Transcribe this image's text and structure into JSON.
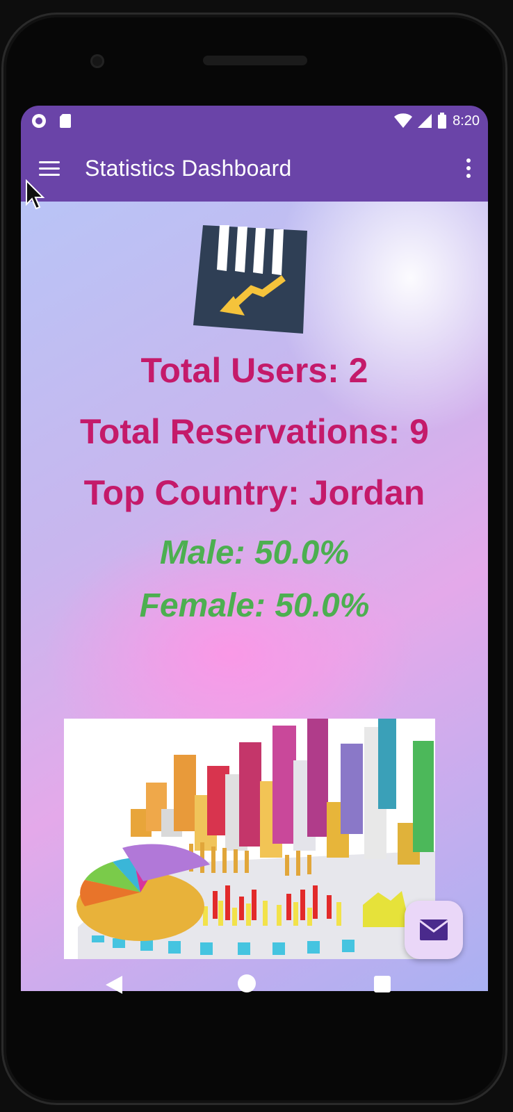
{
  "status_bar": {
    "time": "8:20",
    "left_icons": [
      "circle-notification-icon",
      "sd-card-icon"
    ],
    "right_icons": [
      "wifi-icon",
      "signal-icon",
      "battery-icon"
    ]
  },
  "app_bar": {
    "title": "Statistics Dashboard",
    "menu_icon": "hamburger-menu-icon",
    "overflow_icon": "more-vert-icon"
  },
  "stats": {
    "total_users": "Total Users: 2",
    "total_reservations": "Total Reservations: 9",
    "top_country": "Top Country: Jordan",
    "male": "Male: 50.0%",
    "female": "Female: 50.0%"
  },
  "fab": {
    "icon": "email-icon"
  },
  "nav": {
    "back": "back-icon",
    "home": "home-icon",
    "recents": "recents-icon"
  },
  "colors": {
    "app_bar": "#6a44a8",
    "stat_text": "#c41a6a",
    "percent_text": "#4caf50",
    "fab_bg": "#ead7f8"
  }
}
